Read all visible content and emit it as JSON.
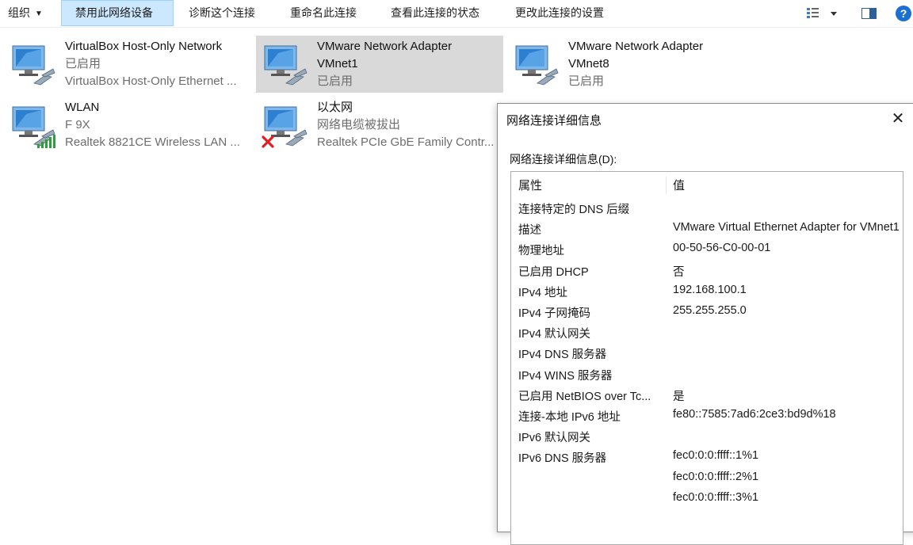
{
  "toolbar": {
    "organize": "组织",
    "disable": "禁用此网络设备",
    "diagnose": "诊断这个连接",
    "rename": "重命名此连接",
    "status": "查看此连接的状态",
    "change": "更改此连接的设置"
  },
  "adapters": [
    {
      "name": "VirtualBox Host-Only Network",
      "line2": "已启用",
      "line3": "VirtualBox Host-Only Ethernet ..."
    },
    {
      "name": "VMware Network Adapter",
      "line2": "VMnet1",
      "line3": "已启用",
      "selected": true
    },
    {
      "name": "VMware Network Adapter",
      "line2": "VMnet8",
      "line3": "已启用"
    },
    {
      "name": "WLAN",
      "line2": "F 9X",
      "line3": "Realtek 8821CE Wireless LAN ..."
    },
    {
      "name": "以太网",
      "line2": "网络电缆被拔出",
      "line3": "Realtek PCIe GbE Family Contr..."
    }
  ],
  "dialog": {
    "title": "网络连接详细信息",
    "label": "网络连接详细信息(D):",
    "col_property": "属性",
    "col_value": "值",
    "rows": [
      {
        "p": "连接特定的 DNS 后缀",
        "v": ""
      },
      {
        "p": "描述",
        "v": "VMware Virtual Ethernet Adapter for VMnet1"
      },
      {
        "p": "物理地址",
        "v": "00-50-56-C0-00-01"
      },
      {
        "p": "已启用 DHCP",
        "v": "否"
      },
      {
        "p": "IPv4 地址",
        "v": "192.168.100.1"
      },
      {
        "p": "IPv4 子网掩码",
        "v": "255.255.255.0"
      },
      {
        "p": "IPv4 默认网关",
        "v": ""
      },
      {
        "p": "IPv4 DNS 服务器",
        "v": ""
      },
      {
        "p": "IPv4 WINS 服务器",
        "v": ""
      },
      {
        "p": "已启用 NetBIOS over Tc...",
        "v": "是"
      },
      {
        "p": "连接-本地 IPv6 地址",
        "v": "fe80::7585:7ad6:2ce3:bd9d%18"
      },
      {
        "p": "IPv6 默认网关",
        "v": ""
      },
      {
        "p": "IPv6 DNS 服务器",
        "v": "fec0:0:0:ffff::1%1"
      },
      {
        "p": "",
        "v": "fec0:0:0:ffff::2%1"
      },
      {
        "p": "",
        "v": "fec0:0:0:ffff::3%1"
      }
    ]
  }
}
